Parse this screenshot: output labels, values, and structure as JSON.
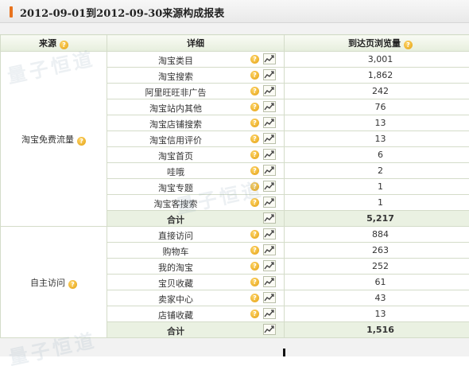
{
  "title": "2012-09-01到2012-09-30来源构成报表",
  "columns": {
    "source": "来源",
    "detail": "详细",
    "views": "到达页浏览量"
  },
  "watermark": "量子恒道",
  "groups": [
    {
      "name": "淘宝免费流量",
      "rows": [
        {
          "detail": "淘宝类目",
          "views": "3,001"
        },
        {
          "detail": "淘宝搜索",
          "views": "1,862"
        },
        {
          "detail": "阿里旺旺非广告",
          "views": "242"
        },
        {
          "detail": "淘宝站内其他",
          "views": "76"
        },
        {
          "detail": "淘宝店铺搜索",
          "views": "13"
        },
        {
          "detail": "淘宝信用评价",
          "views": "13"
        },
        {
          "detail": "淘宝首页",
          "views": "6"
        },
        {
          "detail": "哇哦",
          "views": "2"
        },
        {
          "detail": "淘宝专题",
          "views": "1"
        },
        {
          "detail": "淘宝客搜索",
          "views": "1"
        }
      ],
      "total_label": "合计",
      "total": "5,217"
    },
    {
      "name": "自主访问",
      "rows": [
        {
          "detail": "直接访问",
          "views": "884"
        },
        {
          "detail": "购物车",
          "views": "263"
        },
        {
          "detail": "我的淘宝",
          "views": "252"
        },
        {
          "detail": "宝贝收藏",
          "views": "61"
        },
        {
          "detail": "卖家中心",
          "views": "43"
        },
        {
          "detail": "店铺收藏",
          "views": "13"
        }
      ],
      "total_label": "合计",
      "total": "1,516"
    }
  ],
  "icons": {
    "help": "help-question-icon",
    "trend": "trend-chart-icon"
  },
  "colors": {
    "accent": "#e8731e",
    "header_bg": "#e6eedd",
    "total_bg": "#eaf1e2",
    "border": "#d4dcc9",
    "help_icon": "#e3a011"
  }
}
